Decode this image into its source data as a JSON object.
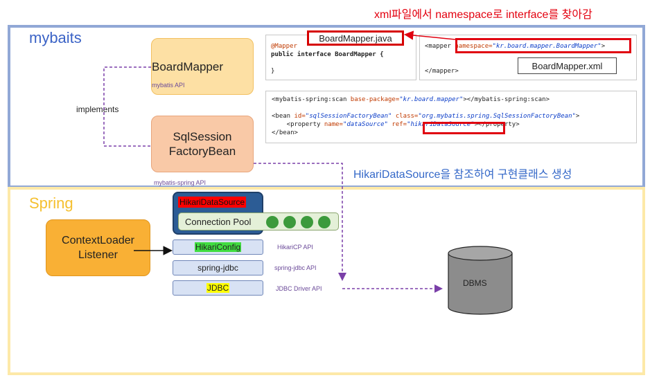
{
  "top_note": "xml파일에서 namespace로 interface를 찾아감",
  "sections": {
    "mybaits": "mybaits",
    "spring": "Spring"
  },
  "boardmapper": {
    "label": "BoardMapper",
    "api": "mybatis API"
  },
  "sqlsessionfactorybean": {
    "line1": "SqlSession",
    "line2": "FactoryBean",
    "api": "mybatis-spring API"
  },
  "implements_label": "implements",
  "code_java": {
    "annotation": "@Mapper",
    "declaration": "public interface BoardMapper {",
    "close": "}",
    "filename": "BoardMapper.java"
  },
  "code_xml": {
    "open_tag": "<mapper",
    "attr_name": "namespace=",
    "attr_value": "\"kr.board.mapper.BoardMapper\"",
    "attr_end": ">",
    "close_tag": "</mapper>",
    "filename": "BoardMapper.xml"
  },
  "code_spring": {
    "scan_open": "<mybatis-spring:scan ",
    "scan_attr": "base-package=",
    "scan_value": "\"kr.board.mapper\"",
    "scan_close": "></mybatis-spring:scan>",
    "bean_open": "<bean ",
    "bean_id_attr": "id=",
    "bean_id_value": "\"sqlSessionFactoryBean\"",
    "bean_class_attr": " class=",
    "bean_class_value": "\"org.mybatis.spring.SqlSessionFactoryBean\"",
    "bean_end": ">",
    "prop_open": "    <property ",
    "prop_name_attr": "name=",
    "prop_name_value": "\"dataSource\"",
    "prop_ref_attr": " ref=",
    "prop_ref_value": "\"hikariDataSource\"",
    "prop_close": "></property>",
    "bean_close": "</bean>"
  },
  "hikari_note": "HikariDataSource을 참조하여 구현클래스 생성",
  "hikari_datasource": {
    "title": "HikariDataSource",
    "pool_label": "Connection Pool"
  },
  "layers": [
    {
      "label": "HikariConfig",
      "api": "HikariCP API"
    },
    {
      "label": "spring-jdbc",
      "api": "spring-jdbc API"
    },
    {
      "label": "JDBC",
      "api": "JDBC Driver API"
    }
  ],
  "context_loader": {
    "line1": "ContextLoader",
    "line2": "Listener"
  },
  "dbms_label": "DBMS",
  "colors": {
    "mybaits_frame": "#91a8d6",
    "spring_frame": "#fde9a8",
    "arrow_purple": "#7a3fa8",
    "highlight_red": "#e0000f"
  }
}
